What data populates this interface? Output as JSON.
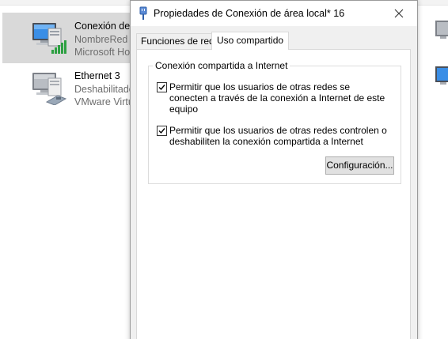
{
  "connections": [
    {
      "name": "Conexión de á",
      "line2": "NombreRed",
      "line3": "Microsoft Ho",
      "icon": "wireless-network-icon",
      "selected": true
    },
    {
      "name": "Ethernet 3",
      "line2": "Deshabilitado",
      "line3": "VMware Virtu",
      "icon": "ethernet-disabled-icon",
      "selected": false
    }
  ],
  "dialog": {
    "title": "Propiedades de Conexión de área local* 16",
    "tabs": [
      {
        "label": "Funciones de red",
        "active": false
      },
      {
        "label": "Uso compartido",
        "active": true
      }
    ],
    "group_title": "Conexión compartida a Internet",
    "options": [
      {
        "label": "Permitir que los usuarios de otras redes se conecten a través de la conexión a Internet de este equipo",
        "checked": true
      },
      {
        "label": "Permitir que los usuarios de otras redes controlen o deshabiliten la conexión compartida a Internet",
        "checked": true
      }
    ],
    "settings_button": "Configuración..."
  },
  "colors": {
    "selection": "#d9d9d9",
    "dialog_bg": "#f0f0f0",
    "button_bg": "#e1e1e1",
    "muted_text": "#6d6d6d"
  }
}
